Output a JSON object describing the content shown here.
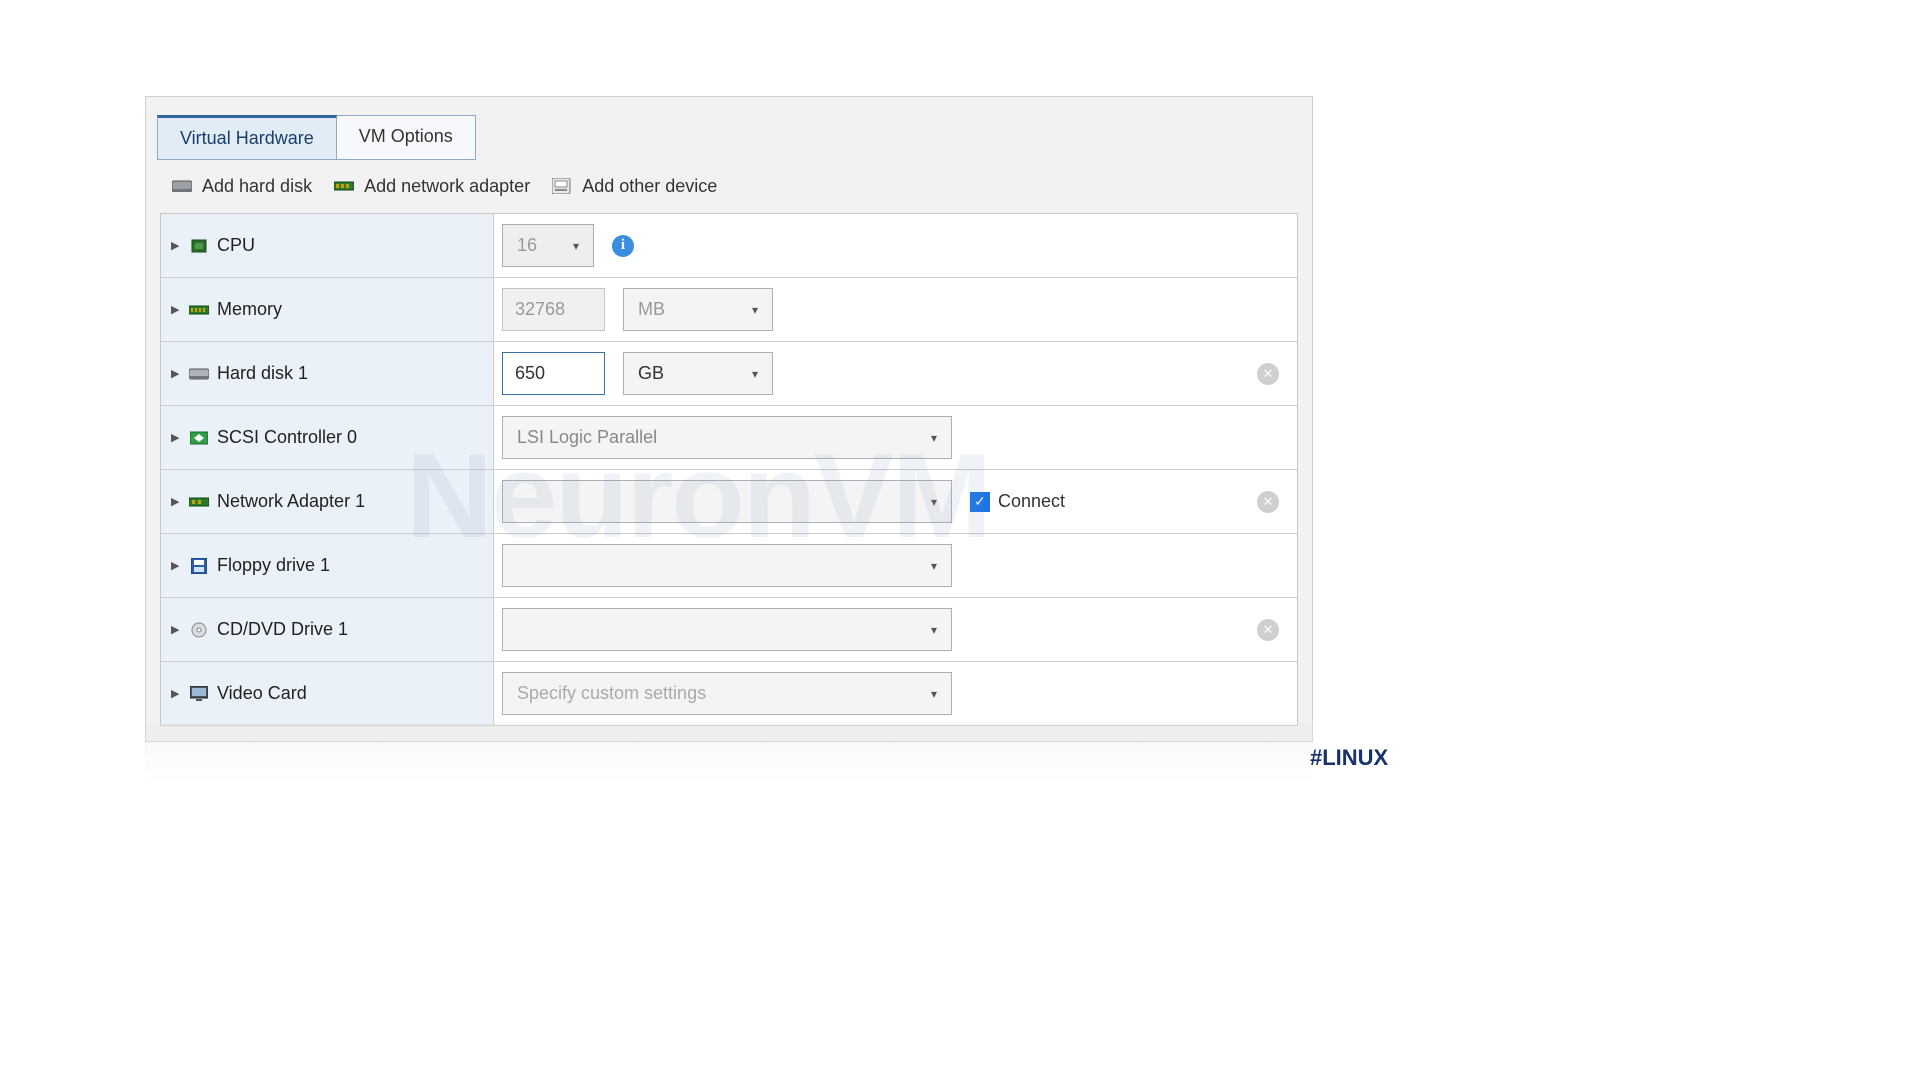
{
  "tabs": {
    "virtual_hardware": "Virtual Hardware",
    "vm_options": "VM Options"
  },
  "toolbar": {
    "add_hard_disk": "Add hard disk",
    "add_network_adapter": "Add network adapter",
    "add_other_device": "Add other device"
  },
  "rows": {
    "cpu": {
      "label": "CPU",
      "value": "16"
    },
    "memory": {
      "label": "Memory",
      "value": "32768",
      "unit": "MB"
    },
    "hard_disk": {
      "label": "Hard disk 1",
      "value": "650",
      "unit": "GB"
    },
    "scsi": {
      "label": "SCSI Controller 0",
      "value": "LSI Logic Parallel"
    },
    "network": {
      "label": "Network Adapter 1",
      "value": "",
      "connect": "Connect",
      "connect_checked": true
    },
    "floppy": {
      "label": "Floppy drive 1",
      "value": ""
    },
    "cddvd": {
      "label": "CD/DVD Drive 1",
      "value": ""
    },
    "video": {
      "label": "Video Card",
      "placeholder": "Specify custom settings"
    }
  },
  "watermark": "NeuronVM",
  "hashtag": "#LINUX"
}
